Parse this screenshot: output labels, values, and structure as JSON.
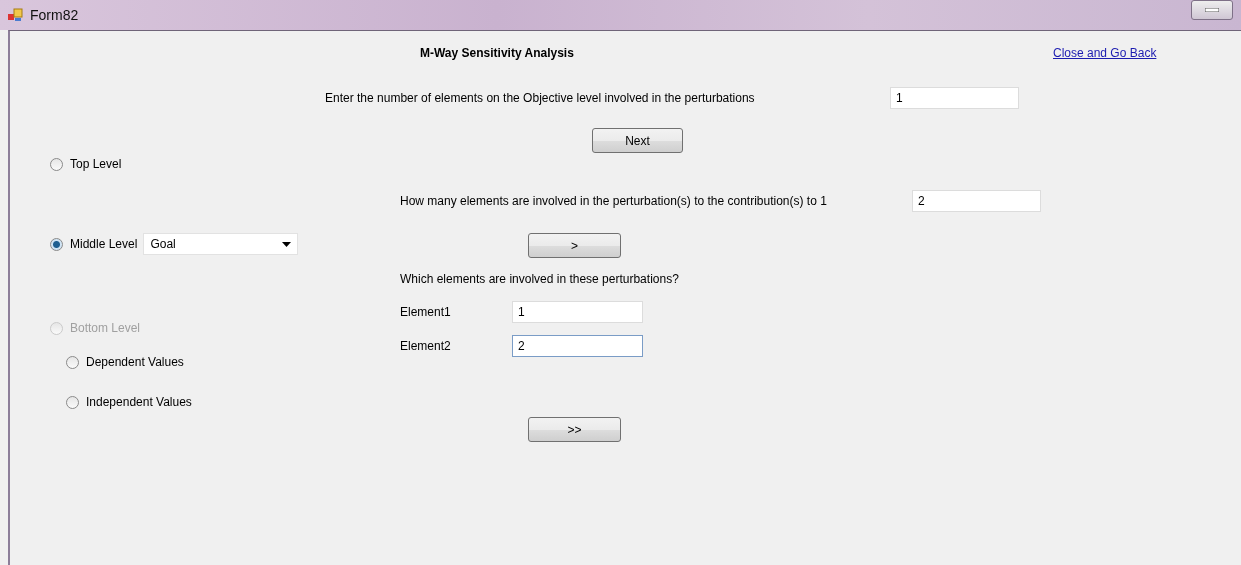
{
  "window": {
    "title": "Form82"
  },
  "heading": "M-Way Sensitivity Analysis",
  "back_link": "Close and Go Back",
  "objective_prompt": {
    "label": "Enter the number of elements on the Objective level involved in the perturbations",
    "value": "1"
  },
  "next_button": "Next",
  "contribution_prompt": {
    "label": "How many elements are involved in the perturbation(s) to the contribution(s) to 1",
    "value": "2"
  },
  "step_button": ">",
  "elements_question": "Which elements are involved in these perturbations?",
  "elements": [
    {
      "label": "Element1",
      "value": "1",
      "focused": false
    },
    {
      "label": "Element2",
      "value": "2",
      "focused": true
    }
  ],
  "finish_button": ">>",
  "levels": [
    {
      "label": "Top Level",
      "selected": false,
      "disabled": false
    },
    {
      "label": "Middle Level",
      "selected": true,
      "disabled": false,
      "dropdown": "Goal"
    },
    {
      "label": "Bottom Level",
      "selected": false,
      "disabled": true
    }
  ],
  "value_types": [
    {
      "label": "Dependent Values",
      "selected": false
    },
    {
      "label": "Independent Values",
      "selected": false
    }
  ]
}
